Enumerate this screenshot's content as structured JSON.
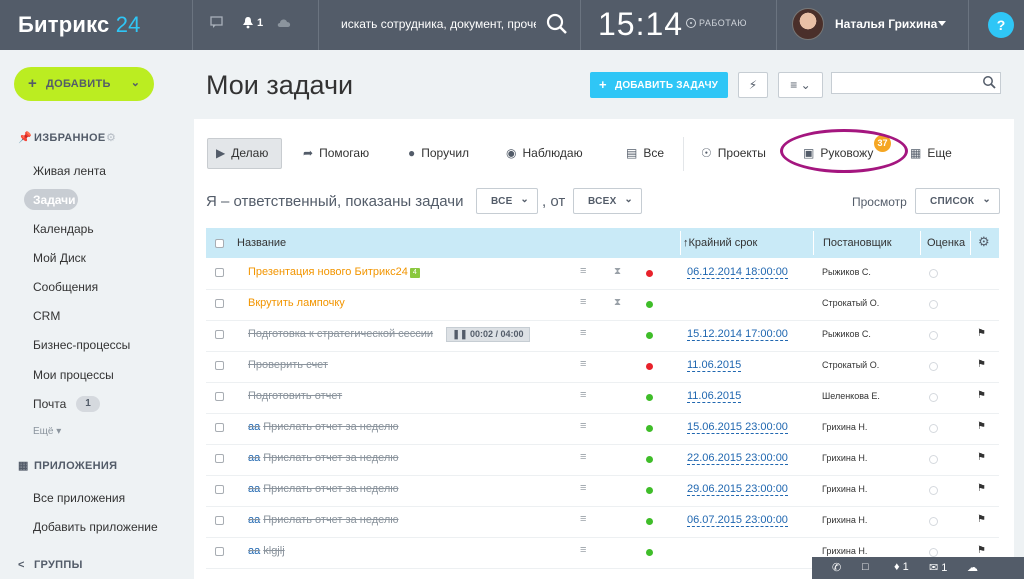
{
  "header": {
    "logo_name": "Битрикс",
    "logo_num": "24",
    "bell_count": "1",
    "search_placeholder": "искать сотрудника, документ, проче",
    "clock": "15:14",
    "work_status": "РАБОТАЮ",
    "user_name": "Наталья Грихина",
    "help_label": "?"
  },
  "sidebar": {
    "add_label": "ДОБАВИТЬ",
    "favorites_title": "ИЗБРАННОЕ",
    "items": [
      "Живая лента",
      "Задачи",
      "Календарь",
      "Мой Диск",
      "Сообщения",
      "CRM",
      "Бизнес-процессы",
      "Мои процессы",
      "Почта"
    ],
    "mail_count": "1",
    "more_label": "Ещё",
    "apps_title": "ПРИЛОЖЕНИЯ",
    "apps_items": [
      "Все приложения",
      "Добавить приложение"
    ],
    "groups_title": "ГРУППЫ"
  },
  "main": {
    "title": "Мои задачи",
    "add_task_label": "ДОБАВИТЬ ЗАДАЧУ",
    "tabs": [
      "Делаю",
      "Помогаю",
      "Поручил",
      "Наблюдаю",
      "Все",
      "Проекты",
      "Руковожу",
      "Еще"
    ],
    "rukovozhu_badge": "37",
    "filter_text": "Я – ответственный, показаны задачи",
    "select1": "ВСЕ",
    "comma_from": ", от",
    "select2": "ВСЕХ",
    "view_label": "Просмотр",
    "view_select": "СПИСОК"
  },
  "table": {
    "headers": {
      "name": "Название",
      "deadline": "Крайний срок",
      "author": "Постановщик",
      "rating": "Оценка"
    },
    "rows": [
      {
        "title": "Презентация нового Битрикс24",
        "prefix": "",
        "deadline": "06.12.2014 18:00:00",
        "author": "Рыжиков С.",
        "status": "red",
        "done": false,
        "badge": "4",
        "hourglass": true,
        "flag": false
      },
      {
        "title": "Вкрутить лампочку",
        "prefix": "",
        "deadline": "",
        "author": "Строкатый О.",
        "status": "green",
        "done": false,
        "badge": "",
        "hourglass": true,
        "flag": false
      },
      {
        "title": "Подготовка к стратегической сессии",
        "prefix": "",
        "deadline": "15.12.2014 17:00:00",
        "author": "Рыжиков С.",
        "status": "green",
        "done": true,
        "badge": "",
        "hourglass": false,
        "flag": true
      },
      {
        "title": "Проверить счет",
        "prefix": "",
        "deadline": "11.06.2015",
        "author": "Строкатый О.",
        "status": "red",
        "done": true,
        "badge": "",
        "hourglass": false,
        "flag": true
      },
      {
        "title": "Подготовить отчет",
        "prefix": "",
        "deadline": "11.06.2015",
        "author": "Шеленкова Е.",
        "status": "green",
        "done": true,
        "badge": "",
        "hourglass": false,
        "flag": true
      },
      {
        "title": "Прислать отчет за неделю",
        "prefix": "аа",
        "deadline": "15.06.2015 23:00:00",
        "author": "Грихина Н.",
        "status": "green",
        "done": true,
        "badge": "",
        "hourglass": false,
        "flag": true
      },
      {
        "title": "Прислать отчет за неделю",
        "prefix": "аа",
        "deadline": "22.06.2015 23:00:00",
        "author": "Грихина Н.",
        "status": "green",
        "done": true,
        "badge": "",
        "hourglass": false,
        "flag": true
      },
      {
        "title": "Прислать отчет за неделю",
        "prefix": "аа",
        "deadline": "29.06.2015 23:00:00",
        "author": "Грихина Н.",
        "status": "green",
        "done": true,
        "badge": "",
        "hourglass": false,
        "flag": true
      },
      {
        "title": "Прислать отчет за неделю",
        "prefix": "аа",
        "deadline": "06.07.2015 23:00:00",
        "author": "Грихина Н.",
        "status": "green",
        "done": true,
        "badge": "",
        "hourglass": false,
        "flag": true
      },
      {
        "title": "klgjlj",
        "prefix": "аа",
        "deadline": "",
        "author": "Грихина Н.",
        "status": "green",
        "done": true,
        "badge": "",
        "hourglass": false,
        "flag": true
      }
    ],
    "timer": "00:02 / 04:00"
  },
  "bottom_bar": {
    "bell_count": "1",
    "mail_count": "1"
  },
  "colors": {
    "header_bg": "#535c69",
    "accent_blue": "#2fc6f6",
    "add_green": "#bbed21",
    "task_orange": "#f29500",
    "highlight": "#a4167f"
  }
}
